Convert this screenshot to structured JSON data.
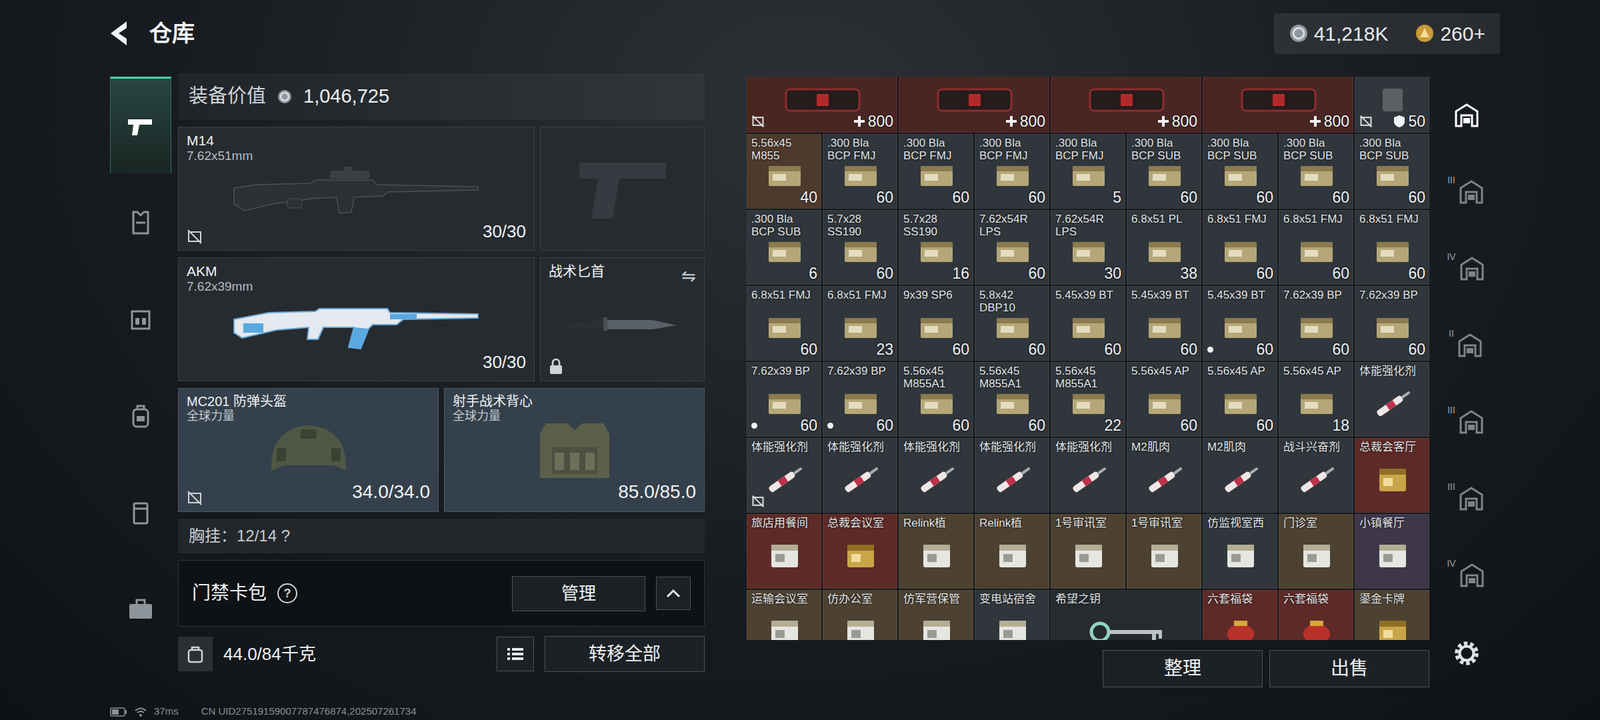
{
  "header": {
    "title": "仓库",
    "currencies": [
      {
        "amount": "41,218K"
      },
      {
        "amount": "260+"
      }
    ]
  },
  "sidebar": {
    "items": [
      {
        "kind": "weapons",
        "selected": true
      },
      {
        "kind": "armor",
        "selected": false
      },
      {
        "kind": "rig",
        "selected": false
      },
      {
        "kind": "backpack",
        "selected": false
      },
      {
        "kind": "pouch",
        "selected": false
      },
      {
        "kind": "case",
        "selected": false
      }
    ]
  },
  "equipment": {
    "value_label": "装备价值",
    "value": "1,046,725",
    "primary": {
      "name": "M14",
      "caliber": "7.62x51mm",
      "ammo": "30/30",
      "bound": true
    },
    "pistol": {
      "empty": true
    },
    "secondary": {
      "name": "AKM",
      "caliber": "7.62x39mm",
      "ammo": "30/30",
      "bound": false
    },
    "melee": {
      "name": "战术匕首",
      "swap": "⇋",
      "locked": true
    },
    "helmet": {
      "name": "MC201 防弹头盔",
      "brand": "全球力量",
      "durability": "34.0/34.0",
      "bound": true
    },
    "vest": {
      "name": "射手战术背心",
      "brand": "全球力量",
      "durability": "85.0/85.0",
      "bound": false
    },
    "chest_rig": {
      "label": "胸挂：12/14 ?"
    }
  },
  "keycard_pack": {
    "label": "门禁卡包",
    "help": "?",
    "manage": "管理"
  },
  "weight": {
    "value": "44.0/84千克"
  },
  "transfer": "转移全部",
  "stash": {
    "items": [
      {
        "kind": "medkit",
        "count": "800",
        "bound": true,
        "marked": false,
        "color": "#4a2623"
      },
      {
        "kind": "medkit",
        "count": "800",
        "bound": false,
        "marked": false,
        "color": "#4a2623"
      },
      {
        "kind": "medkit",
        "count": "800",
        "bound": false,
        "marked": false,
        "color": "#4a2623"
      },
      {
        "kind": "medkit",
        "count": "800",
        "bound": false,
        "marked": false,
        "color": "#4a2623"
      },
      {
        "kind": "plate",
        "count": "50",
        "bound": true,
        "marked": false,
        "color": "#30363c"
      },
      {
        "kind": "ammo",
        "name": "5.56x45 M855",
        "count": "40",
        "bound": false,
        "marked": false,
        "color": "#4d3a2c"
      },
      {
        "kind": "ammo",
        "name": ".300 Bla BCP FMJ",
        "count": "60",
        "bound": false,
        "marked": false,
        "color": "#30363c"
      },
      {
        "kind": "ammo",
        "name": ".300 Bla BCP FMJ",
        "count": "60",
        "bound": false,
        "marked": false,
        "color": "#30363c"
      },
      {
        "kind": "ammo",
        "name": ".300 Bla BCP FMJ",
        "count": "60",
        "bound": false,
        "marked": false,
        "color": "#30363c"
      },
      {
        "kind": "ammo",
        "name": ".300 Bla BCP FMJ",
        "count": "5",
        "bound": false,
        "marked": false,
        "color": "#30363c"
      },
      {
        "kind": "ammo",
        "name": ".300 Bla BCP SUB",
        "count": "60",
        "bound": false,
        "marked": false,
        "color": "#30363c"
      },
      {
        "kind": "ammo",
        "name": ".300 Bla BCP SUB",
        "count": "60",
        "bound": false,
        "marked": false,
        "color": "#30363c"
      },
      {
        "kind": "ammo",
        "name": ".300 Bla BCP SUB",
        "count": "60",
        "bound": false,
        "marked": false,
        "color": "#30363c"
      },
      {
        "kind": "ammo",
        "name": ".300 Bla BCP SUB",
        "count": "60",
        "bound": false,
        "marked": false,
        "color": "#30363c"
      },
      {
        "kind": "ammo",
        "name": ".300 Bla BCP SUB",
        "count": "6",
        "bound": false,
        "marked": false,
        "color": "#30363c"
      },
      {
        "kind": "ammo",
        "name": "5.7x28 SS190",
        "count": "60",
        "bound": false,
        "marked": false,
        "color": "#30363c"
      },
      {
        "kind": "ammo",
        "name": "5.7x28 SS190",
        "count": "16",
        "bound": false,
        "marked": false,
        "color": "#30363c"
      },
      {
        "kind": "ammo",
        "name": "7.62x54R LPS",
        "count": "60",
        "bound": false,
        "marked": false,
        "color": "#30363c"
      },
      {
        "kind": "ammo",
        "name": "7.62x54R LPS",
        "count": "30",
        "bound": false,
        "marked": false,
        "color": "#30363c"
      },
      {
        "kind": "ammo",
        "name": "6.8x51 PL",
        "count": "38",
        "bound": false,
        "marked": false,
        "color": "#30363c"
      },
      {
        "kind": "ammo",
        "name": "6.8x51 FMJ",
        "count": "60",
        "bound": false,
        "marked": false,
        "color": "#30363c"
      },
      {
        "kind": "ammo",
        "name": "6.8x51 FMJ",
        "count": "60",
        "bound": false,
        "marked": false,
        "color": "#30363c"
      },
      {
        "kind": "ammo",
        "name": "6.8x51 FMJ",
        "count": "60",
        "bound": false,
        "marked": false,
        "color": "#30363c"
      },
      {
        "kind": "ammo",
        "name": "6.8x51 FMJ",
        "count": "60",
        "bound": false,
        "marked": false,
        "color": "#30363c"
      },
      {
        "kind": "ammo",
        "name": "6.8x51 FMJ",
        "count": "23",
        "bound": false,
        "marked": false,
        "color": "#30363c"
      },
      {
        "kind": "ammo",
        "name": "9x39 SP6",
        "count": "60",
        "bound": false,
        "marked": false,
        "color": "#30363c"
      },
      {
        "kind": "ammo",
        "name": "5.8x42 DBP10",
        "count": "60",
        "bound": false,
        "marked": false,
        "color": "#30363c"
      },
      {
        "kind": "ammo",
        "name": "5.45x39 BT",
        "count": "60",
        "bound": false,
        "marked": false,
        "color": "#30363c"
      },
      {
        "kind": "ammo",
        "name": "5.45x39 BT",
        "count": "60",
        "bound": false,
        "marked": false,
        "color": "#30363c"
      },
      {
        "kind": "ammo",
        "name": "5.45x39 BT",
        "count": "60",
        "bound": false,
        "marked": true,
        "color": "#30363c"
      },
      {
        "kind": "ammo",
        "name": "7.62x39 BP",
        "count": "60",
        "bound": false,
        "marked": false,
        "color": "#30363c"
      },
      {
        "kind": "ammo",
        "name": "7.62x39 BP",
        "count": "60",
        "bound": false,
        "marked": false,
        "color": "#30363c"
      },
      {
        "kind": "ammo",
        "name": "7.62x39 BP",
        "count": "60",
        "bound": false,
        "marked": true,
        "color": "#30363c"
      },
      {
        "kind": "ammo",
        "name": "7.62x39 BP",
        "count": "60",
        "bound": false,
        "marked": true,
        "color": "#30363c"
      },
      {
        "kind": "ammo",
        "name": "5.56x45 M855A1",
        "count": "60",
        "bound": false,
        "marked": false,
        "color": "#30363c"
      },
      {
        "kind": "ammo",
        "name": "5.56x45 M855A1",
        "count": "60",
        "bound": false,
        "marked": false,
        "color": "#30363c"
      },
      {
        "kind": "ammo",
        "name": "5.56x45 M855A1",
        "count": "22",
        "bound": false,
        "marked": false,
        "color": "#30363c"
      },
      {
        "kind": "ammo",
        "name": "5.56x45 AP",
        "count": "60",
        "bound": false,
        "marked": false,
        "color": "#30363c"
      },
      {
        "kind": "ammo",
        "name": "5.56x45 AP",
        "count": "60",
        "bound": false,
        "marked": false,
        "color": "#30363c"
      },
      {
        "kind": "ammo",
        "name": "5.56x45 AP",
        "count": "18",
        "bound": false,
        "marked": false,
        "color": "#30363c"
      },
      {
        "kind": "injector",
        "name": "体能强化剂",
        "bound": false,
        "marked": false,
        "color": "#30363c"
      },
      {
        "kind": "injector",
        "name": "体能强化剂",
        "bound": true,
        "marked": false,
        "color": "#30363c"
      },
      {
        "kind": "injector",
        "name": "体能强化剂",
        "bound": false,
        "marked": false,
        "color": "#30363c"
      },
      {
        "kind": "injector",
        "name": "体能强化剂",
        "bound": false,
        "marked": false,
        "color": "#30363c"
      },
      {
        "kind": "injector",
        "name": "体能强化剂",
        "bound": false,
        "marked": false,
        "color": "#30363c"
      },
      {
        "kind": "injector",
        "name": "体能强化剂",
        "bound": false,
        "marked": false,
        "color": "#30363c"
      },
      {
        "kind": "injector",
        "name": "M2肌肉",
        "bound": false,
        "marked": false,
        "color": "#30363c"
      },
      {
        "kind": "injector",
        "name": "M2肌肉",
        "bound": false,
        "marked": false,
        "color": "#30363c"
      },
      {
        "kind": "injector",
        "name": "战斗兴奋剂",
        "bound": false,
        "marked": false,
        "color": "#30363c"
      },
      {
        "kind": "card",
        "name": "总裁会客厅",
        "bound": false,
        "marked": false,
        "color": "#5e2a28"
      },
      {
        "kind": "keycard",
        "name": "旅店用餐间",
        "bound": false,
        "marked": false,
        "color": "#5e2a28"
      },
      {
        "kind": "card",
        "name": "总裁会议室",
        "bound": false,
        "marked": false,
        "color": "#5e2a28"
      },
      {
        "kind": "keycard",
        "name": "Relink植",
        "bound": false,
        "marked": false,
        "color": "#4d4132"
      },
      {
        "kind": "keycard",
        "name": "Relink植",
        "bound": false,
        "marked": false,
        "color": "#4d4132"
      },
      {
        "kind": "keycard",
        "name": "1号审讯室",
        "bound": false,
        "marked": false,
        "color": "#4d4132"
      },
      {
        "kind": "keycard",
        "name": "1号审讯室",
        "bound": false,
        "marked": false,
        "color": "#4d4132"
      },
      {
        "kind": "keycard",
        "name": "仿监视室西",
        "bound": false,
        "marked": false,
        "color": "#30363c"
      },
      {
        "kind": "keycard",
        "name": "门诊室",
        "bound": false,
        "marked": false,
        "color": "#4d4132"
      },
      {
        "kind": "keycard",
        "name": "小镇餐厅",
        "bound": false,
        "marked": false,
        "color": "#3d3748"
      },
      {
        "kind": "keycard",
        "name": "运输会议室",
        "bound": false,
        "marked": false,
        "color": "#4d4132"
      },
      {
        "kind": "keycard",
        "name": "仿办公室",
        "bound": false,
        "marked": false,
        "color": "#4d4132"
      },
      {
        "kind": "keycard",
        "name": "仿军营保管",
        "bound": false,
        "marked": false,
        "color": "#4d4132"
      },
      {
        "kind": "keycard",
        "name": "变电站宿舍",
        "bound": false,
        "marked": false,
        "color": "#30363c"
      },
      {
        "kind": "key",
        "name": "希望之钥",
        "bound": false,
        "marked": false,
        "color": "#262b30"
      },
      {
        "kind": "bag",
        "name": "六套福袋",
        "bound": false,
        "marked": false,
        "color": "#5e2a28"
      },
      {
        "kind": "bag",
        "name": "六套福袋",
        "bound": false,
        "marked": false,
        "color": "#5e2a28"
      },
      {
        "kind": "card",
        "name": "鎏金卡牌",
        "bound": false,
        "marked": false,
        "color": "#4d4132"
      }
    ],
    "buttons": [
      "整理",
      "出售"
    ]
  },
  "tabs": [
    {
      "selected": true
    },
    {
      "badge": "III",
      "selected": false
    },
    {
      "badge": "IV",
      "selected": false
    },
    {
      "badge": "II",
      "selected": false
    },
    {
      "badge": "III",
      "selected": false
    },
    {
      "badge": "III",
      "selected": false
    },
    {
      "badge": "IV",
      "selected": false
    }
  ],
  "status": {
    "ping": "37ms",
    "uid": "CN UID27519159007787476874,202507261734"
  }
}
